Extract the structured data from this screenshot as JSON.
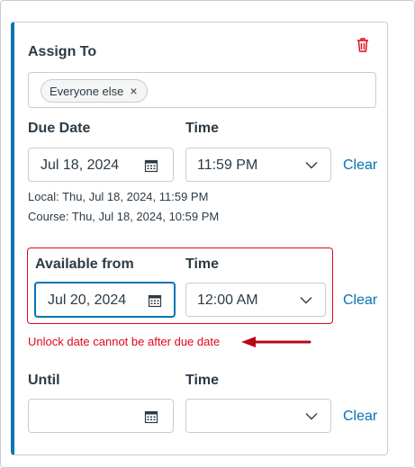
{
  "assign_to": {
    "heading": "Assign To",
    "tag_label": "Everyone else",
    "tag_remove_glyph": "×",
    "delete_icon": "trash-icon"
  },
  "due": {
    "date_heading": "Due Date",
    "time_heading": "Time",
    "date_value": "Jul 18, 2024",
    "time_value": "11:59 PM",
    "clear_label": "Clear",
    "local_text": "Local: Thu, Jul 18, 2024, 11:59 PM",
    "course_text": "Course: Thu, Jul 18, 2024, 10:59 PM"
  },
  "available": {
    "date_heading": "Available from",
    "time_heading": "Time",
    "date_value": "Jul 20, 2024",
    "time_value": "12:00 AM",
    "clear_label": "Clear",
    "error_message": "Unlock date cannot be after due date"
  },
  "until": {
    "date_heading": "Until",
    "time_heading": "Time",
    "date_value": "",
    "time_value": "",
    "clear_label": "Clear"
  },
  "colors": {
    "accent": "#0374b5",
    "error": "#e0061f",
    "annotation_arrow": "#b8071a",
    "text": "#2d3b45",
    "border": "#c7cdd1"
  },
  "icons": [
    "trash-icon",
    "close-icon",
    "calendar-icon",
    "chevron-down-icon",
    "arrow-left-icon"
  ]
}
